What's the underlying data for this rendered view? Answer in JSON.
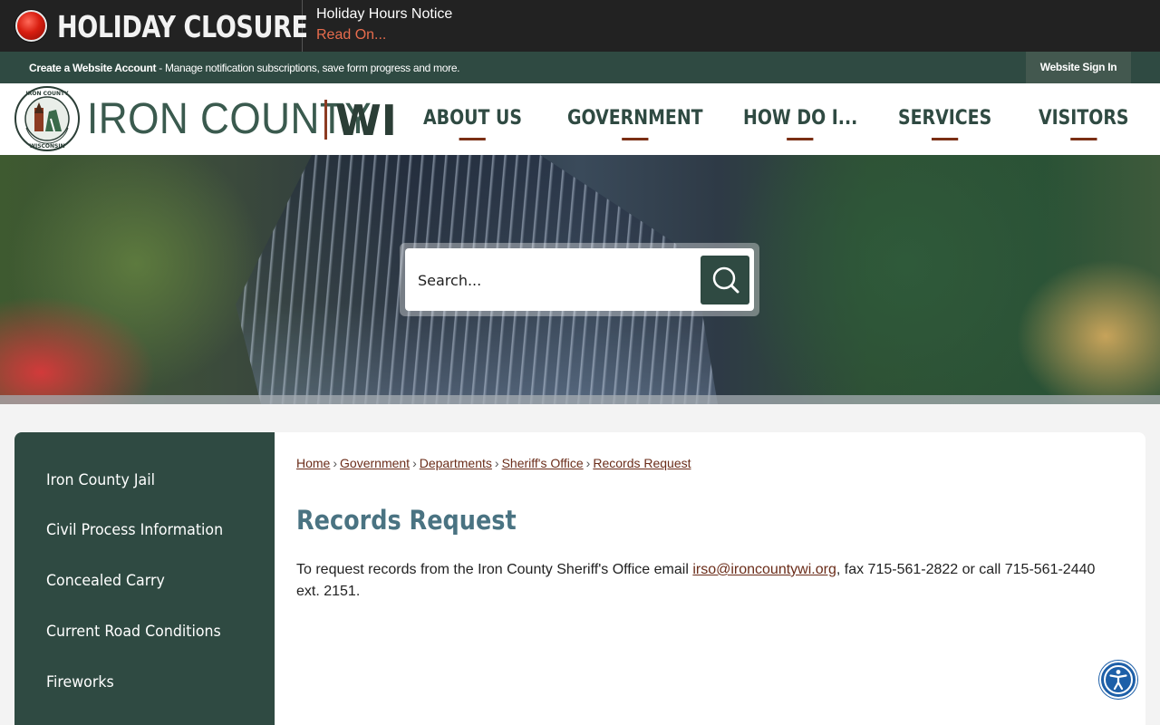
{
  "alert": {
    "title": "HOLIDAY CLOSURE",
    "notice_title": "Holiday Hours Notice",
    "read_more": "Read On..."
  },
  "account_bar": {
    "create_link": "Create a Website Account",
    "description": " - Manage notification subscriptions, save form progress and more.",
    "signin": "Website Sign In"
  },
  "brand": {
    "name": "IRON COUNTY",
    "suffix": "WI",
    "seal_top": "IRON COUNTY",
    "seal_bottom": "WISCONSIN"
  },
  "nav": {
    "items": [
      {
        "label": "ABOUT US"
      },
      {
        "label": "GOVERNMENT"
      },
      {
        "label": "HOW DO I..."
      },
      {
        "label": "SERVICES"
      },
      {
        "label": "VISITORS"
      }
    ]
  },
  "search": {
    "placeholder": "Search..."
  },
  "sidebar": {
    "items": [
      {
        "label": "Iron County Jail"
      },
      {
        "label": "Civil Process Information"
      },
      {
        "label": "Concealed Carry"
      },
      {
        "label": "Current Road Conditions"
      },
      {
        "label": "Fireworks"
      }
    ]
  },
  "breadcrumb": {
    "items": [
      {
        "label": "Home"
      },
      {
        "label": "Government"
      },
      {
        "label": "Departments"
      },
      {
        "label": "Sheriff's Office"
      },
      {
        "label": "Records Request"
      }
    ],
    "separator": "›"
  },
  "page": {
    "title": "Records Request",
    "text_before": "To request records from the Iron County Sheriff's Office email ",
    "email": "irso@ironcountywi.org",
    "text_after": ", fax 715-561-2822 or call 715-561-2440 ext. 2151."
  },
  "colors": {
    "brand_green": "#2f4a42",
    "accent_rust": "#7a2e14",
    "title_blue": "#4a7382",
    "alert_red": "#d81e10"
  },
  "icons": {
    "alert": "red-alert-dot-icon",
    "search": "search-icon",
    "accessibility": "accessibility-icon"
  }
}
